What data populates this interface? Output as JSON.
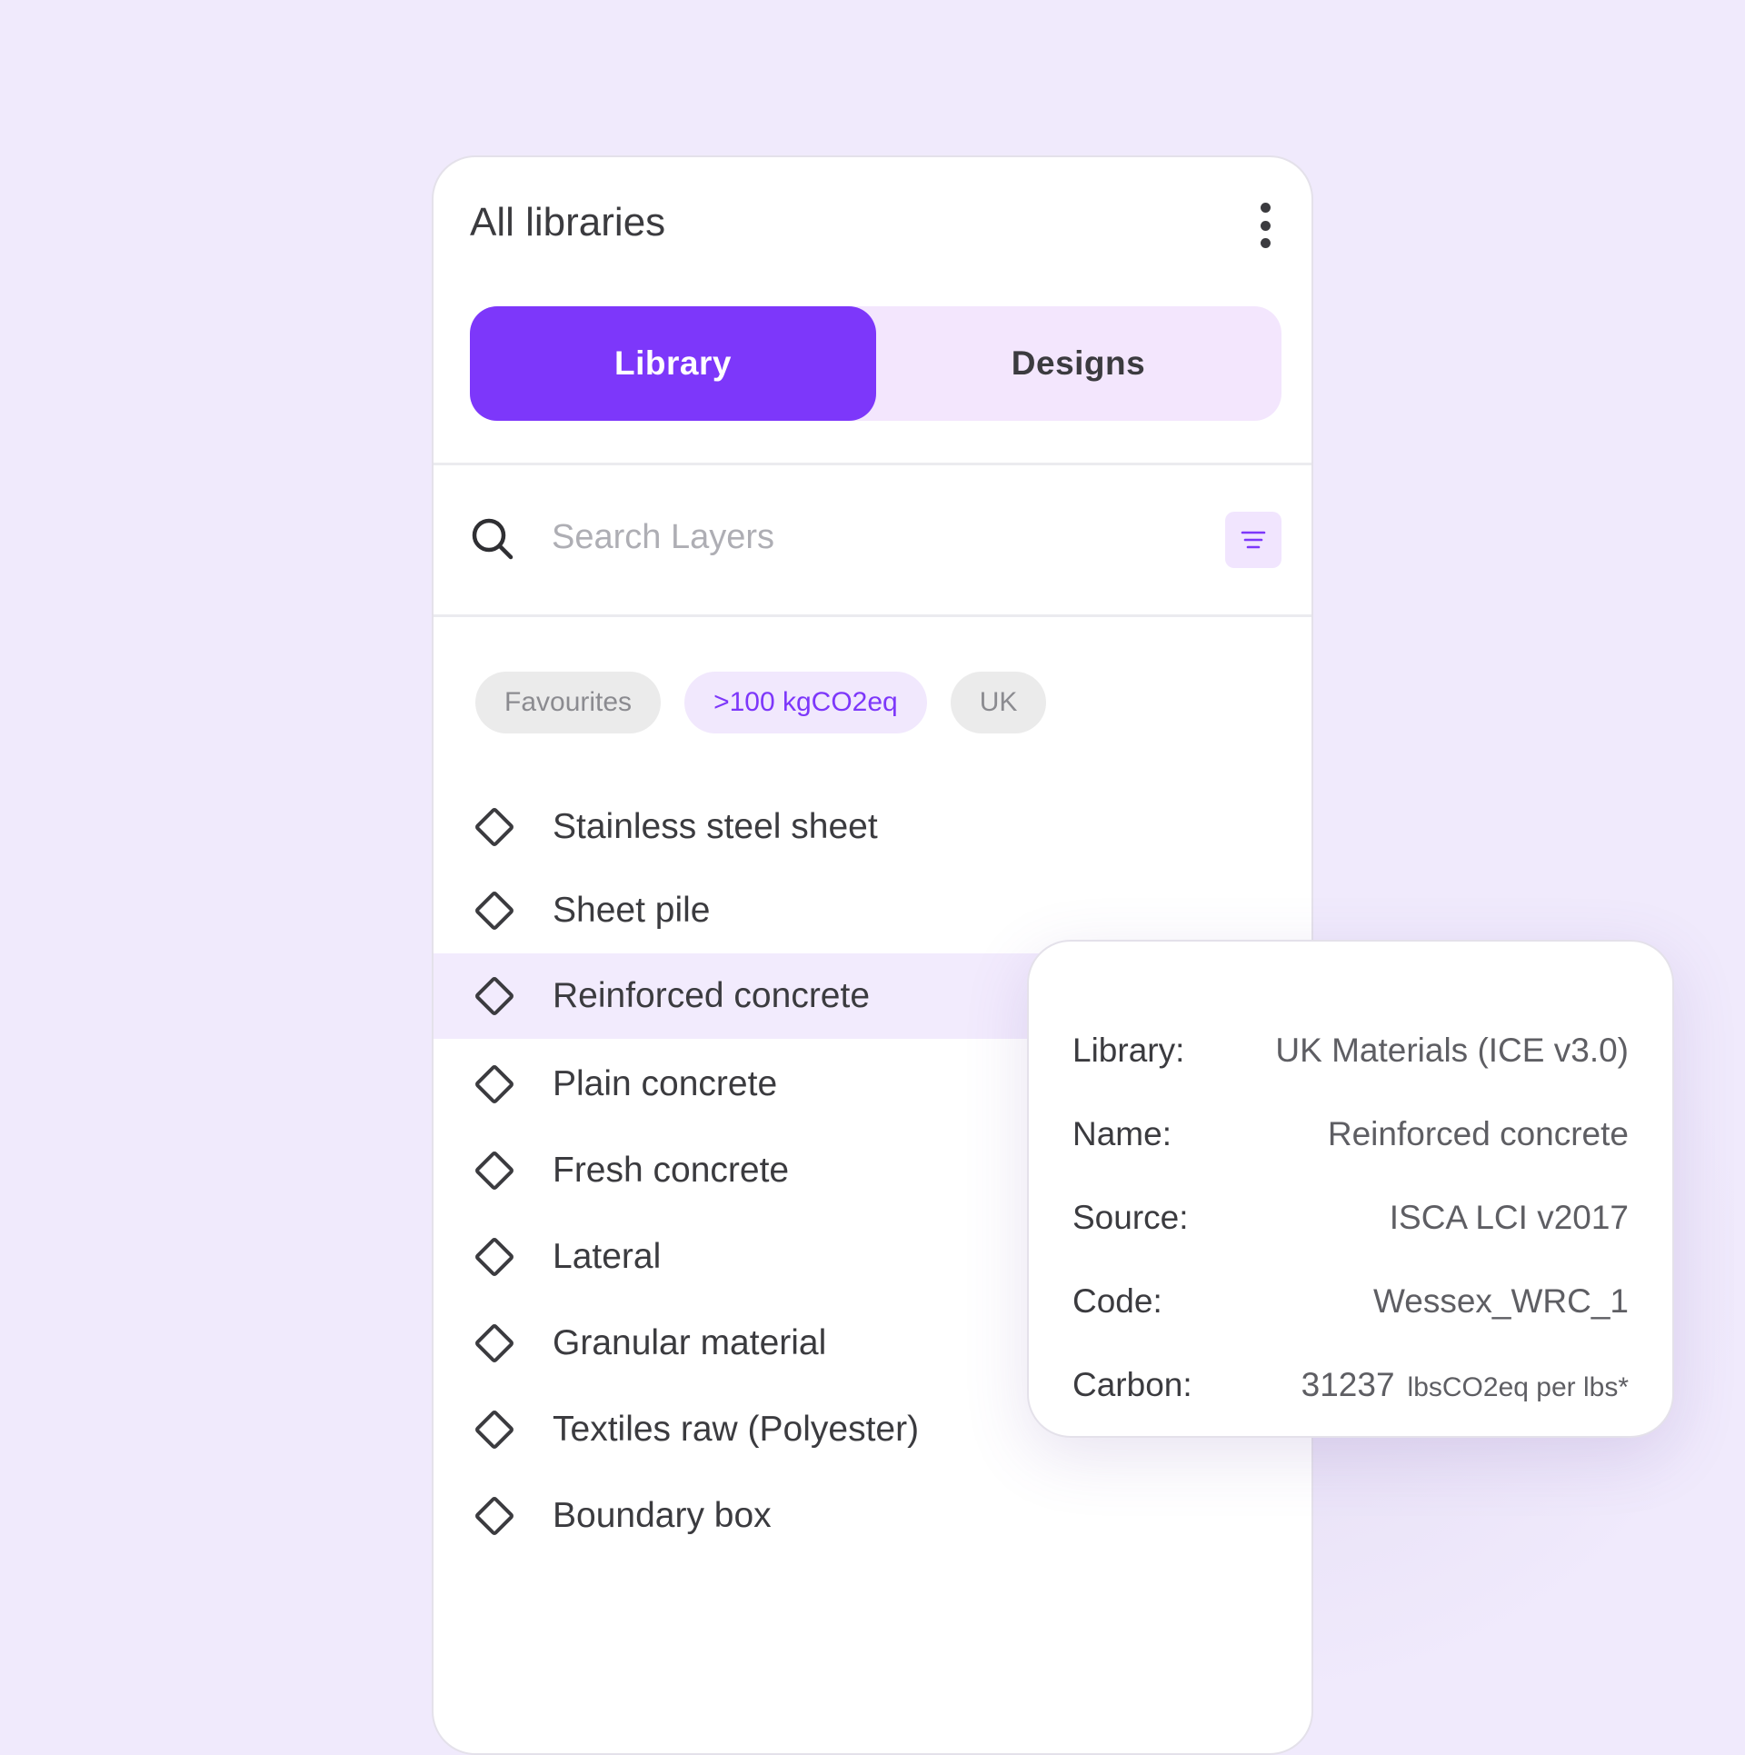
{
  "panel": {
    "title": "All libraries",
    "more_icon": "more-vertical-icon"
  },
  "tabs": [
    {
      "label": "Library",
      "active": true
    },
    {
      "label": "Designs",
      "active": false
    }
  ],
  "search": {
    "placeholder": "Search Layers",
    "icon": "search-icon",
    "filter_icon": "filter-lines-icon"
  },
  "chips": [
    {
      "label": "Favourites",
      "style": "grey"
    },
    {
      "label": ">100 kgCO2eq",
      "style": "purple"
    },
    {
      "label": "UK",
      "style": "grey"
    }
  ],
  "items": [
    {
      "label": "Stainless steel sheet",
      "selected": false
    },
    {
      "label": "Sheet pile",
      "selected": false
    },
    {
      "label": "Reinforced concrete",
      "selected": true
    },
    {
      "label": "Plain concrete",
      "selected": false
    },
    {
      "label": "Fresh concrete",
      "selected": false
    },
    {
      "label": "Lateral",
      "selected": false
    },
    {
      "label": "Granular material",
      "selected": false
    },
    {
      "label": "Textiles raw (Polyester)",
      "selected": false
    },
    {
      "label": "Boundary box",
      "selected": false
    }
  ],
  "details": {
    "library_label": "Library:",
    "library_value": "UK Materials (ICE v3.0)",
    "name_label": "Name:",
    "name_value": "Reinforced concrete",
    "source_label": "Source:",
    "source_value": "ISCA LCI v2017",
    "code_label": "Code:",
    "code_value": "Wessex_WRC_1",
    "carbon_label": "Carbon:",
    "carbon_value": "31237",
    "carbon_unit": "lbsCO2eq per lbs*"
  },
  "colors": {
    "accent": "#7D37FA",
    "accent_light": "#F3E6FD",
    "background": "#F0EAFC",
    "text": "#3B3B3F"
  }
}
